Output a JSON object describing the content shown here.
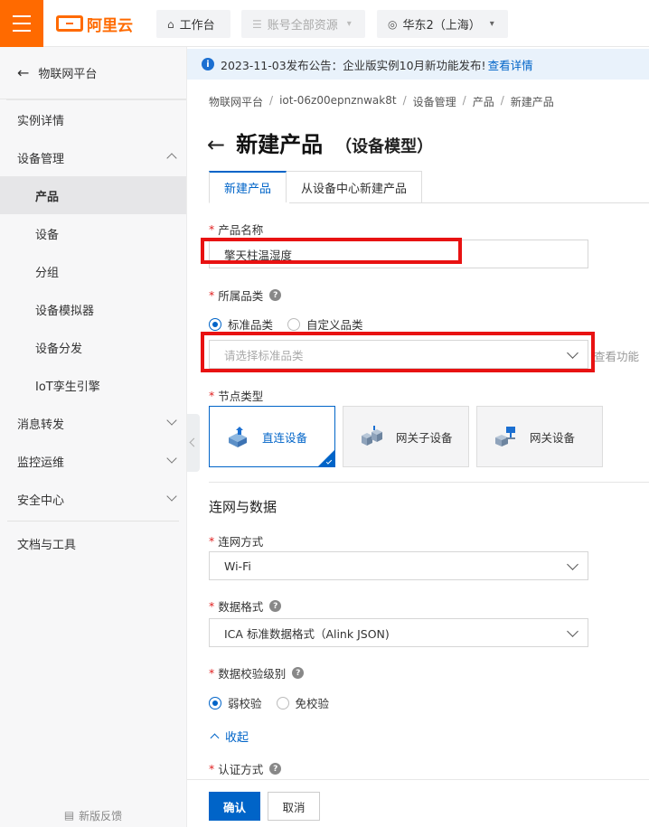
{
  "topbar": {
    "logo_text": "阿里云",
    "workbench_label": "工作台",
    "resources_label": "账号全部资源",
    "region_label": "华东2（上海）",
    "brand_color": "#ff6a00"
  },
  "sidebar": {
    "back_label": "物联网平台",
    "items": [
      {
        "label": "实例详情"
      },
      {
        "label": "设备管理"
      },
      {
        "label": "产品"
      },
      {
        "label": "设备"
      },
      {
        "label": "分组"
      },
      {
        "label": "设备模拟器"
      },
      {
        "label": "设备分发"
      },
      {
        "label": "IoT孪生引擎"
      },
      {
        "label": "消息转发"
      },
      {
        "label": "监控运维"
      },
      {
        "label": "安全中心"
      },
      {
        "label": "文档与工具"
      }
    ],
    "feedback_label": "新版反馈"
  },
  "notice": {
    "text": "2023-11-03发布公告：企业版实例10月新功能发布!",
    "link": "查看详情"
  },
  "breadcrumb": [
    "物联网平台",
    "iot-06z00epnznwak8t",
    "设备管理",
    "产品",
    "新建产品"
  ],
  "page": {
    "title": "新建产品",
    "subtitle": "（设备模型）"
  },
  "tabs": [
    "新建产品",
    "从设备中心新建产品"
  ],
  "form": {
    "product_name": {
      "label": "产品名称",
      "value": "擎天柱温湿度"
    },
    "category": {
      "label": "所属品类",
      "options": [
        "标准品类",
        "自定义品类"
      ],
      "selected": "标准品类",
      "placeholder": "请选择标准品类",
      "side_link": "查看功能"
    },
    "node_type": {
      "label": "节点类型",
      "options": [
        "直连设备",
        "网关子设备",
        "网关设备"
      ],
      "selected": "直连设备"
    },
    "section_title": "连网与数据",
    "network": {
      "label": "连网方式",
      "value": "Wi-Fi"
    },
    "data_format": {
      "label": "数据格式",
      "value": "ICA 标准数据格式（Alink JSON)"
    },
    "verify_level": {
      "label": "数据校验级别",
      "options": [
        "弱校验",
        "免校验"
      ],
      "selected": "弱校验"
    },
    "collapse_label": "收起",
    "auth": {
      "label": "认证方式"
    }
  },
  "buttons": {
    "confirm": "确认",
    "cancel": "取消"
  },
  "colors": {
    "accent": "#0064c8",
    "annotation_red": "#e81212"
  }
}
